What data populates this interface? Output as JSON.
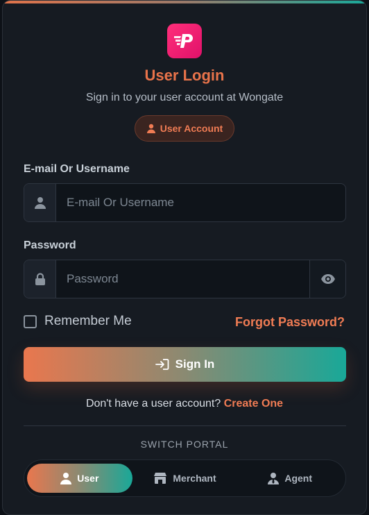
{
  "header": {
    "title": "User Login",
    "subtitle": "Sign in to your user account at Wongate",
    "badge_label": "User Account"
  },
  "form": {
    "email_label": "E-mail Or Username",
    "email_placeholder": "E-mail Or Username",
    "email_value": "",
    "password_label": "Password",
    "password_placeholder": "Password",
    "password_value": "",
    "remember_label": "Remember Me",
    "remember_checked": false,
    "forgot_label": "Forgot Password?",
    "signin_label": "Sign In"
  },
  "register": {
    "prompt": "Don't have a user account?",
    "link_label": "Create One"
  },
  "portal_switch": {
    "title": "SWITCH PORTAL",
    "items": [
      {
        "label": "User",
        "icon": "user-icon",
        "active": true
      },
      {
        "label": "Merchant",
        "icon": "store-icon",
        "active": false
      },
      {
        "label": "Agent",
        "icon": "agent-icon",
        "active": false
      }
    ]
  },
  "colors": {
    "accent": "#e8734a",
    "teal": "#19a898",
    "logo": "#ff2f7a",
    "background": "#161b22"
  },
  "icons": {
    "logo": "brand-logo-icon",
    "badge": "user-icon",
    "email_addon": "user-icon",
    "password_addon": "lock-icon",
    "password_toggle": "eye-icon",
    "signin": "sign-in-icon"
  }
}
